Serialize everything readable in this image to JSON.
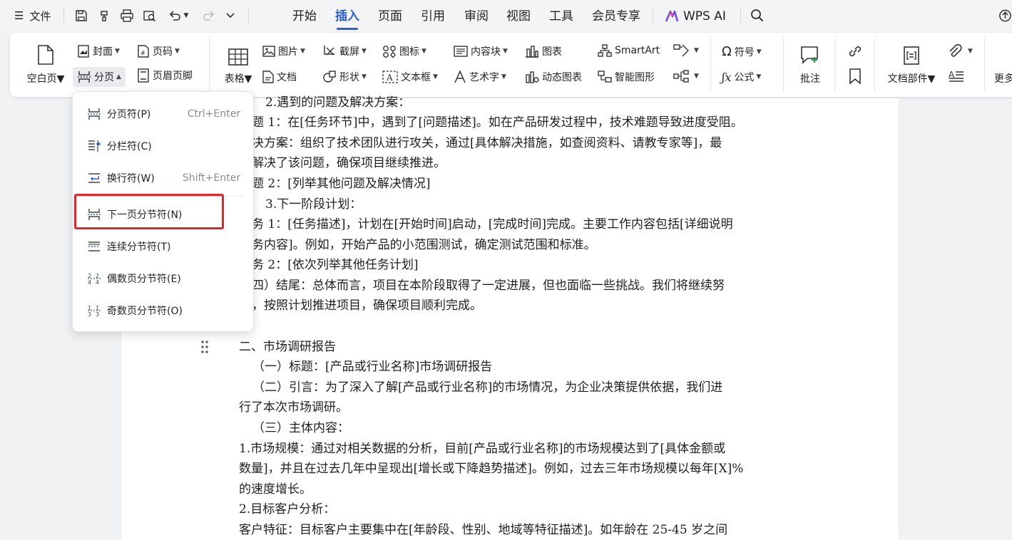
{
  "topbar": {
    "file_label": "文件",
    "tabs": [
      "开始",
      "插入",
      "页面",
      "引用",
      "审阅",
      "视图",
      "工具",
      "会员专享"
    ],
    "active_tab": "插入",
    "wps_ai_label": "WPS AI"
  },
  "ribbon": {
    "blank_page": "空白页",
    "cover": "封面",
    "page_number": "页码",
    "page_break": "分页",
    "header_footer": "页眉页脚",
    "table": "表格",
    "picture": "图片",
    "document": "文档",
    "screenshot": "截屏",
    "shape": "形状",
    "icon": "图标",
    "text_box": "文本框",
    "content_block": "内容块",
    "art_text": "艺术字",
    "chart": "图表",
    "dynamic_chart": "动态图表",
    "smartart": "SmartArt",
    "smart_shape": "智能图形",
    "symbol": "符号",
    "formula": "公式",
    "comment": "批注",
    "doc_parts": "文档部件",
    "more": "更多"
  },
  "menu": {
    "items": [
      {
        "label": "分页符(P)",
        "shortcut": "Ctrl+Enter"
      },
      {
        "label": "分栏符(C)",
        "shortcut": ""
      },
      {
        "label": "换行符(W)",
        "shortcut": "Shift+Enter"
      },
      {
        "label": "下一页分节符(N)",
        "shortcut": ""
      },
      {
        "label": "连续分节符(T)",
        "shortcut": ""
      },
      {
        "label": "偶数页分节符(E)",
        "shortcut": ""
      },
      {
        "label": "奇数页分节符(O)",
        "shortcut": ""
      }
    ]
  },
  "document": {
    "lines": [
      "2.遇到的问题及解决方案：",
      "题 1：在[任务环节]中，遇到了[问题描述]。如在产品研发过程中，技术难题导致进度受阻。",
      "决方案：组织了技术团队进行攻关，通过[具体解决措施，如查阅资料、请教专家等]，最",
      "解决了该问题，确保项目继续推进。",
      "题 2：[列举其他问题及解决情况]",
      "3.下一阶段计划：",
      "务 1：[任务描述]，计划在[开始时间]启动，[完成时间]完成。主要工作内容包括[详细说明",
      "务内容]。例如，开始产品的小范围测试，确定测试范围和标准。",
      "务 2：[依次列举其他任务计划]",
      "四）结尾：总体而言，项目在本阶段取得了一定进展，但也面临一些挑战。我们将继续努",
      "，按照计划推进项目，确保项目顺利完成。",
      "二、市场调研报告",
      "（一）标题：[产品或行业名称]市场调研报告",
      "（二）引言：为了深入了解[产品或行业名称]的市场情况，为企业决策提供依据，我们进",
      "行了本次市场调研。",
      "（三）主体内容：",
      "1.市场规模：通过对相关数据的分析，目前[产品或行业名称]的市场规模达到了[具体金额或",
      "数量]，并且在过去几年中呈现出[增长或下降趋势描述]。例如，过去三年市场规模以每年[X]%",
      "的速度增长。",
      "2.目标客户分析：",
      "客户特征：目标客户主要集中在[年龄段、性别、地域等特征描述]。如年龄在 25-45 岁之间"
    ]
  }
}
